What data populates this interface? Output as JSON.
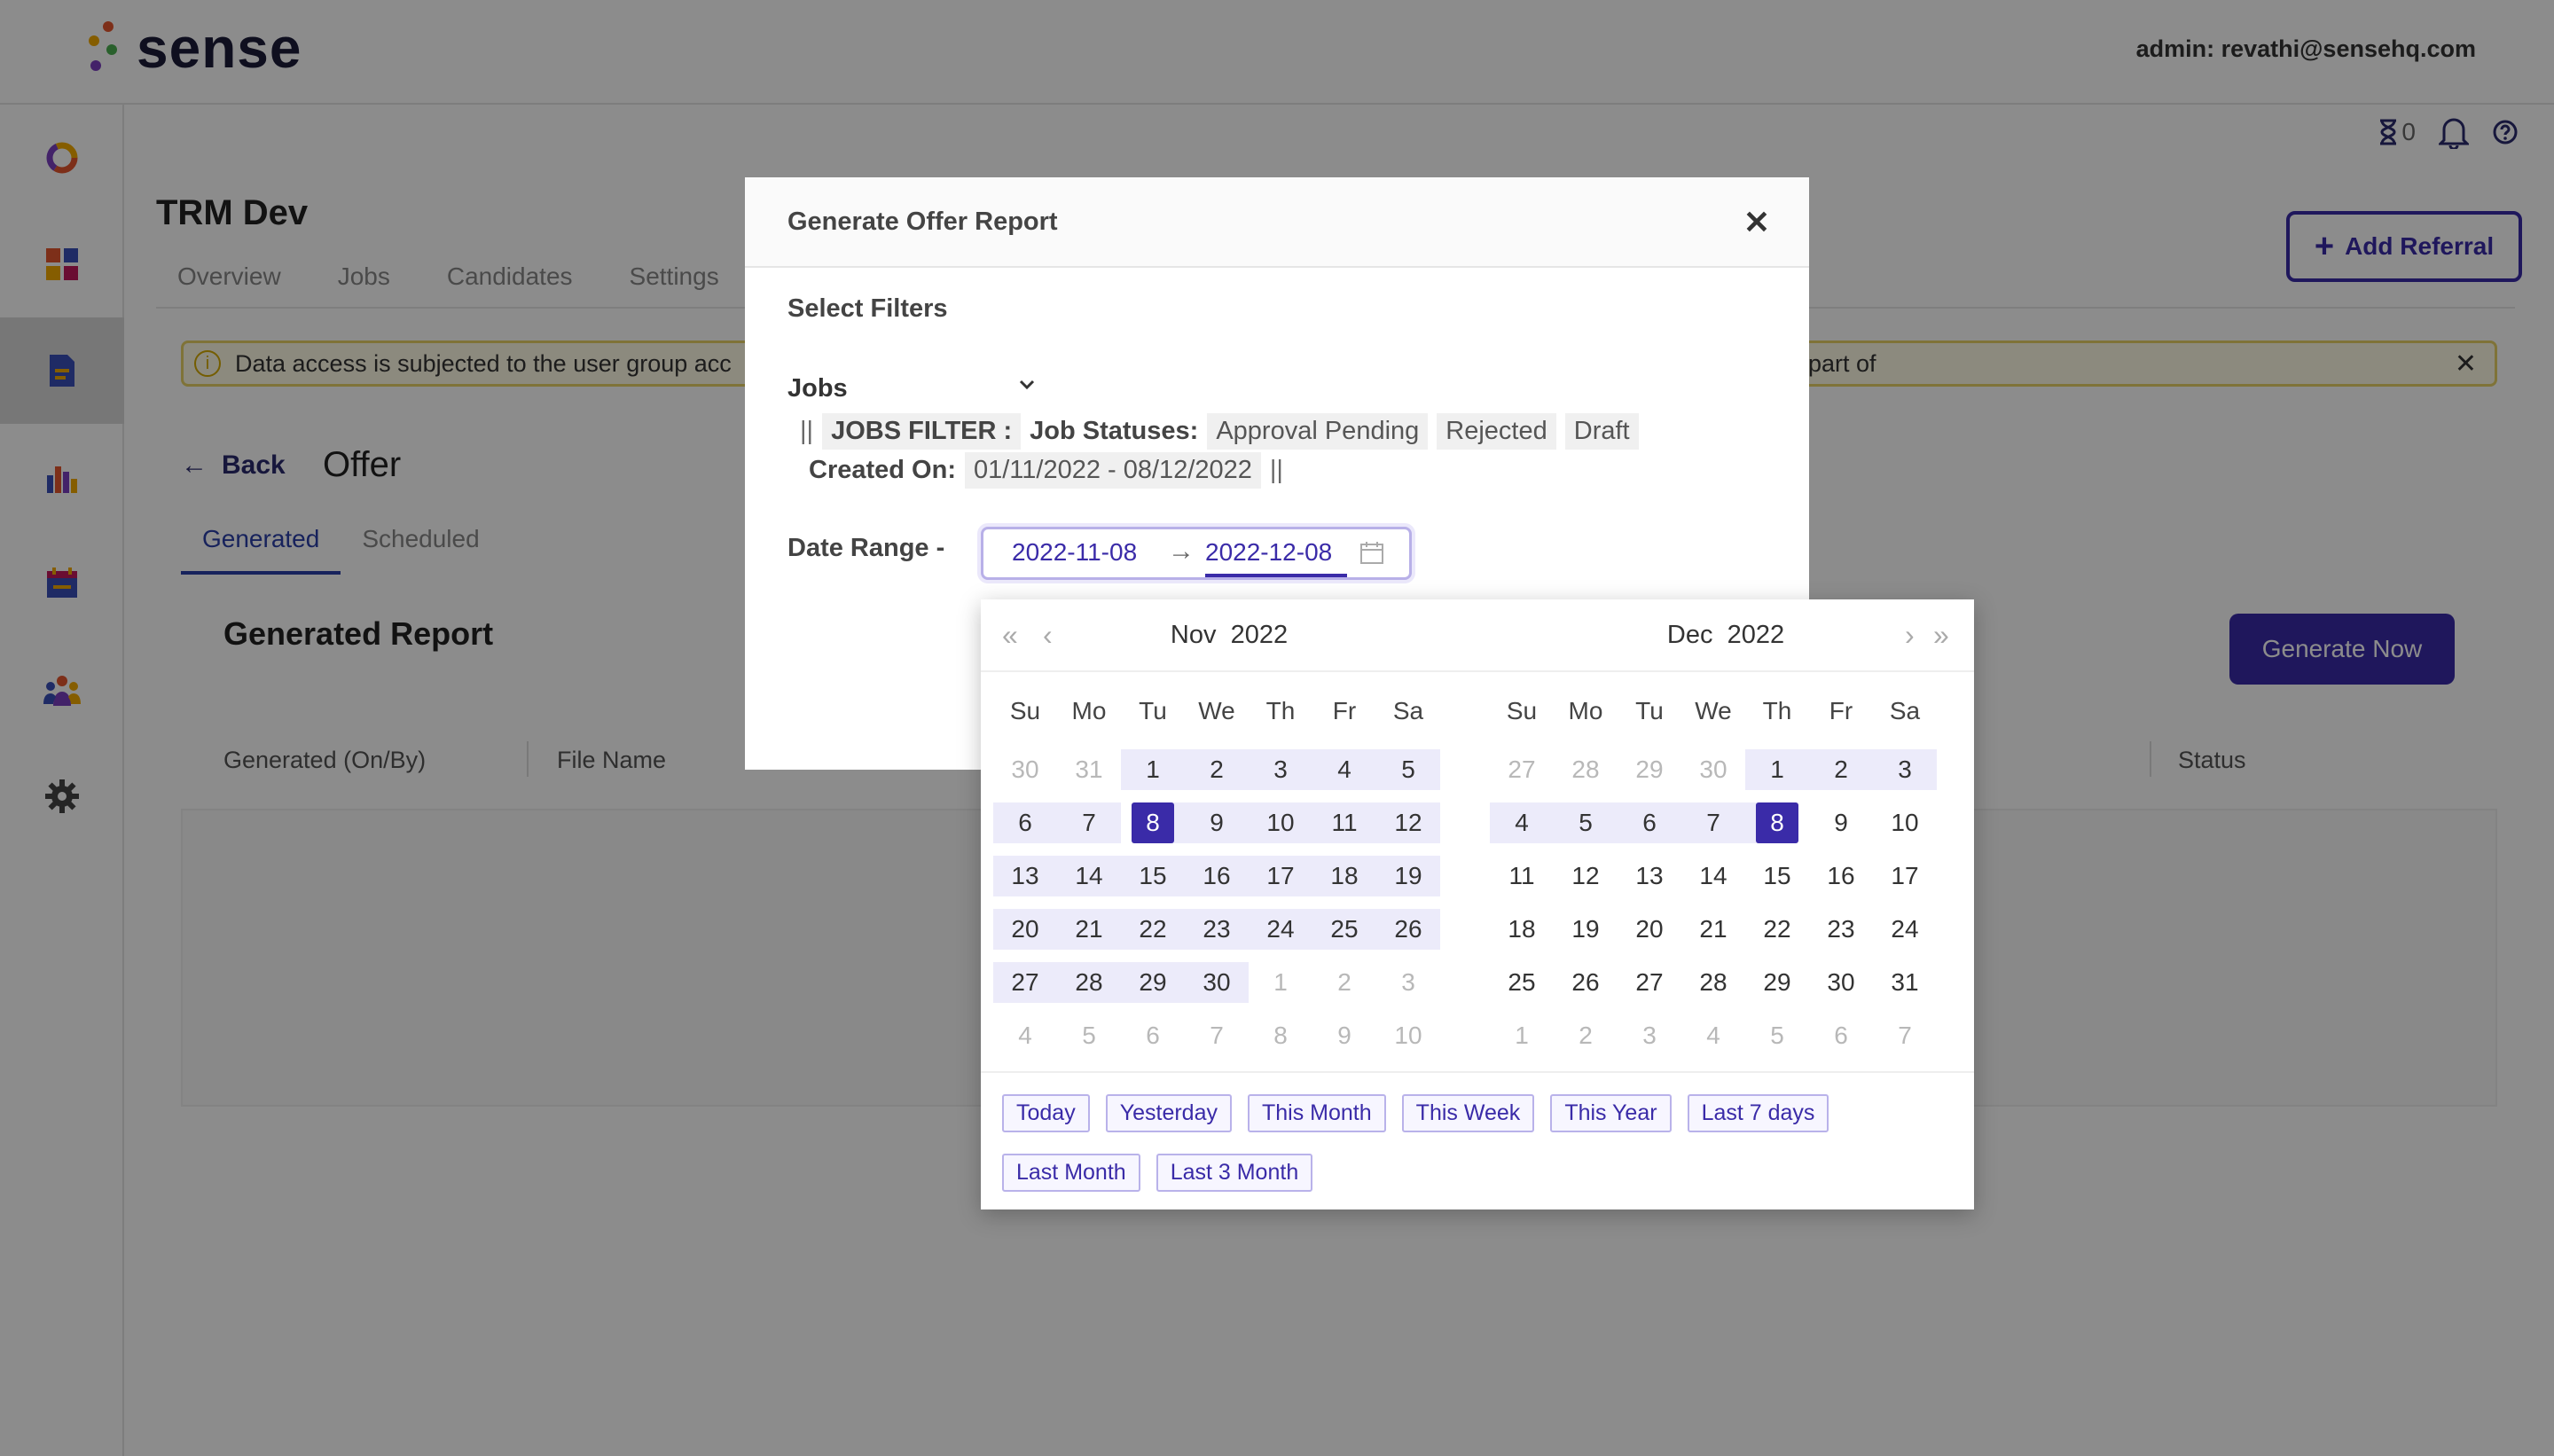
{
  "app": {
    "brand": "sense",
    "admin": "admin: revathi@sensehq.com"
  },
  "util": {
    "hourglass_count": "0"
  },
  "page": {
    "project": "TRM Dev",
    "tabs": [
      "Overview",
      "Jobs",
      "Candidates",
      "Settings"
    ],
    "add_referral": "Add Referral",
    "notice_left": "Data access is subjected to the user group acc",
    "notice_right": "part of",
    "back": "Back",
    "title": "Offer",
    "subtabs": [
      "Generated",
      "Scheduled"
    ],
    "report_title": "Generated Report",
    "generate_now": "Generate Now",
    "columns": [
      "Generated (On/By)",
      "File Name",
      "Status"
    ]
  },
  "modal": {
    "title": "Generate Offer Report",
    "select_filters": "Select Filters",
    "jobs_label": "Jobs",
    "pipe": "||",
    "jobs_filter": "JOBS FILTER :",
    "job_statuses_label": "Job Statuses:",
    "statuses": [
      "Approval Pending",
      "Rejected",
      "Draft"
    ],
    "created_on_label": "Created On:",
    "created_on_value": "01/11/2022 - 08/12/2022",
    "date_range_label": "Date Range -",
    "start_date": "2022-11-08",
    "end_date": "2022-12-08"
  },
  "picker": {
    "weekdays": [
      "Su",
      "Mo",
      "Tu",
      "We",
      "Th",
      "Fr",
      "Sa"
    ],
    "left": {
      "month": "Nov",
      "year": "2022",
      "days": [
        [
          "30",
          "m"
        ],
        [
          "31",
          "m"
        ],
        [
          "1",
          "r"
        ],
        [
          "2",
          "r"
        ],
        [
          "3",
          "r"
        ],
        [
          "4",
          "r"
        ],
        [
          "5",
          "r"
        ],
        [
          "6",
          "r"
        ],
        [
          "7",
          "r"
        ],
        [
          "8",
          "s"
        ],
        [
          "9",
          "r"
        ],
        [
          "10",
          "r"
        ],
        [
          "11",
          "r"
        ],
        [
          "12",
          "r"
        ],
        [
          "13",
          "r"
        ],
        [
          "14",
          "r"
        ],
        [
          "15",
          "r"
        ],
        [
          "16",
          "r"
        ],
        [
          "17",
          "r"
        ],
        [
          "18",
          "r"
        ],
        [
          "19",
          "r"
        ],
        [
          "20",
          "r"
        ],
        [
          "21",
          "r"
        ],
        [
          "22",
          "r"
        ],
        [
          "23",
          "r"
        ],
        [
          "24",
          "r"
        ],
        [
          "25",
          "r"
        ],
        [
          "26",
          "r"
        ],
        [
          "27",
          "r"
        ],
        [
          "28",
          "r"
        ],
        [
          "29",
          "r"
        ],
        [
          "30",
          "r"
        ],
        [
          "1",
          "m"
        ],
        [
          "2",
          "m"
        ],
        [
          "3",
          "m"
        ],
        [
          "4",
          "m"
        ],
        [
          "5",
          "m"
        ],
        [
          "6",
          "m"
        ],
        [
          "7",
          "m"
        ],
        [
          "8",
          "m"
        ],
        [
          "9",
          "m"
        ],
        [
          "10",
          "m"
        ]
      ]
    },
    "right": {
      "month": "Dec",
      "year": "2022",
      "days": [
        [
          "27",
          "m"
        ],
        [
          "28",
          "m"
        ],
        [
          "29",
          "m"
        ],
        [
          "30",
          "m"
        ],
        [
          "1",
          "r"
        ],
        [
          "2",
          "r"
        ],
        [
          "3",
          "r"
        ],
        [
          "4",
          "r"
        ],
        [
          "5",
          "r"
        ],
        [
          "6",
          "r"
        ],
        [
          "7",
          "r"
        ],
        [
          "8",
          "e"
        ],
        [
          "9",
          "n"
        ],
        [
          "10",
          "n"
        ],
        [
          "11",
          "n"
        ],
        [
          "12",
          "n"
        ],
        [
          "13",
          "n"
        ],
        [
          "14",
          "n"
        ],
        [
          "15",
          "n"
        ],
        [
          "16",
          "n"
        ],
        [
          "17",
          "n"
        ],
        [
          "18",
          "n"
        ],
        [
          "19",
          "n"
        ],
        [
          "20",
          "n"
        ],
        [
          "21",
          "n"
        ],
        [
          "22",
          "n"
        ],
        [
          "23",
          "n"
        ],
        [
          "24",
          "n"
        ],
        [
          "25",
          "n"
        ],
        [
          "26",
          "n"
        ],
        [
          "27",
          "n"
        ],
        [
          "28",
          "n"
        ],
        [
          "29",
          "n"
        ],
        [
          "30",
          "n"
        ],
        [
          "31",
          "n"
        ],
        [
          "1",
          "m"
        ],
        [
          "2",
          "m"
        ],
        [
          "3",
          "m"
        ],
        [
          "4",
          "m"
        ],
        [
          "5",
          "m"
        ],
        [
          "6",
          "m"
        ],
        [
          "7",
          "m"
        ]
      ]
    },
    "presets": [
      "Today",
      "Yesterday",
      "This Month",
      "This Week",
      "This Year",
      "Last 7 days",
      "Last Month",
      "Last 3 Month"
    ]
  },
  "colors": {
    "accent": "#3a2ba8",
    "range_bg": "#ecebfa",
    "notice_border": "#e8d266"
  }
}
